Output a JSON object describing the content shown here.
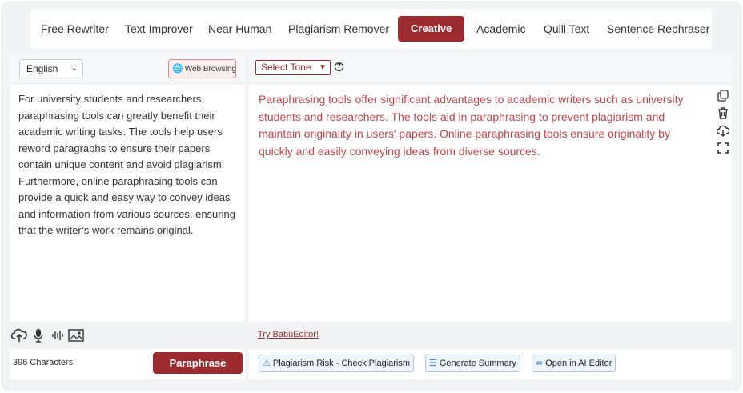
{
  "modes": [
    "Free Rewriter",
    "Text Improver",
    "Near Human",
    "Plagiarism Remover",
    "Creative",
    "Academic",
    "Quill Text",
    "Sentence Rephraser"
  ],
  "active_mode": "Creative",
  "input": {
    "language": "English",
    "web_browsing_label": "Web Browsing",
    "text": "For university students and researchers, paraphrasing tools can greatly benefit their academic writing tasks. The tools help users reword paragraphs to ensure their papers contain unique content and avoid plagiarism. Furthermore, online paraphrasing tools can provide a quick and easy way to convey ideas and information from various sources, ensuring that the writer’s work remains original.",
    "char_count": "396 Characters",
    "paraphrase_label": "Paraphrase",
    "tool_icons": [
      "upload-cloud-icon",
      "microphone-icon",
      "audio-wave-icon",
      "image-icon"
    ]
  },
  "output": {
    "tone_label": "Select Tone",
    "text": "Paraphrasing tools offer significant advantages to academic writers such as university students and researchers. The tools aid in paraphrasing to prevent plagiarism and maintain originality in users' papers. Online paraphrasing tools ensure originality by quickly and easily conveying ideas from diverse sources.",
    "side_icons": [
      "copy-icon",
      "trash-icon",
      "download-cloud-icon",
      "fullscreen-icon"
    ],
    "try_link": "Try BabuEditor!",
    "actions": [
      "Plagiarism Risk - Check Plagiarism",
      "Generate Summary",
      "Open in AI Editor"
    ]
  },
  "colors": {
    "accent": "#9c2b2f",
    "output_text": "#c0454c",
    "chip_border": "#a9c7e4"
  }
}
